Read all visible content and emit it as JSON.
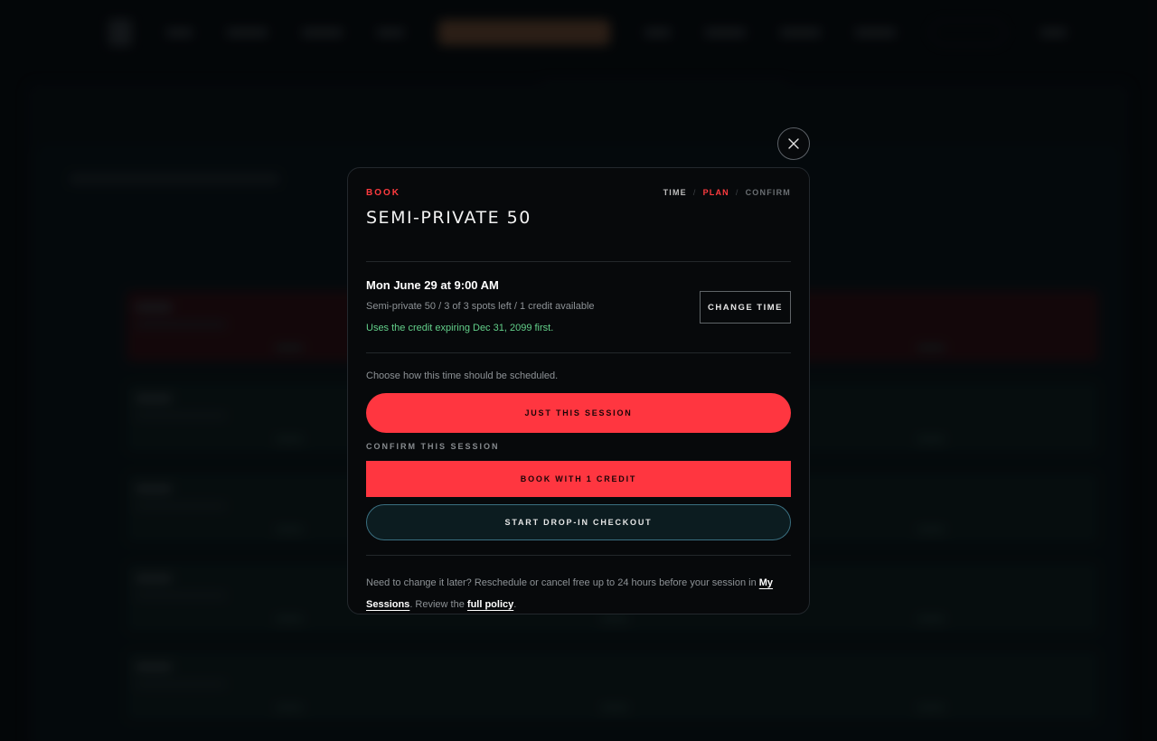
{
  "modal": {
    "eyebrow": "BOOK",
    "title": "SEMI-PRIVATE 50",
    "steps": [
      {
        "label": "TIME",
        "state": "done"
      },
      {
        "label": "PLAN",
        "state": "active"
      },
      {
        "label": "CONFIRM",
        "state": "todo"
      }
    ],
    "step_separator": "/",
    "session": {
      "time": "Mon June 29 at 9:00 AM",
      "details": "Semi-private 50 / 3 of 3 spots left / 1 credit available",
      "credit_note": "Uses the credit expiring Dec 31, 2099 first.",
      "change_time_label": "CHANGE TIME"
    },
    "schedule": {
      "prompt": "Choose how this time should be scheduled.",
      "just_this_session_label": "JUST THIS SESSION",
      "confirm_label": "CONFIRM THIS SESSION",
      "book_credit_label": "BOOK WITH 1 CREDIT",
      "drop_in_label": "START DROP-IN CHECKOUT"
    },
    "policy": {
      "text_before": "Need to change it later? Reschedule or cancel free up to 24 hours before your session in ",
      "my_sessions_link": "My Sessions",
      "text_middle": ". Review the ",
      "full_policy_link": "full policy",
      "text_after": "."
    }
  },
  "colors": {
    "accent": "#ff3640",
    "success": "#63d08a",
    "background": "#05080a",
    "modal_background": "#07090b"
  },
  "icons": {
    "close": "close-icon"
  }
}
